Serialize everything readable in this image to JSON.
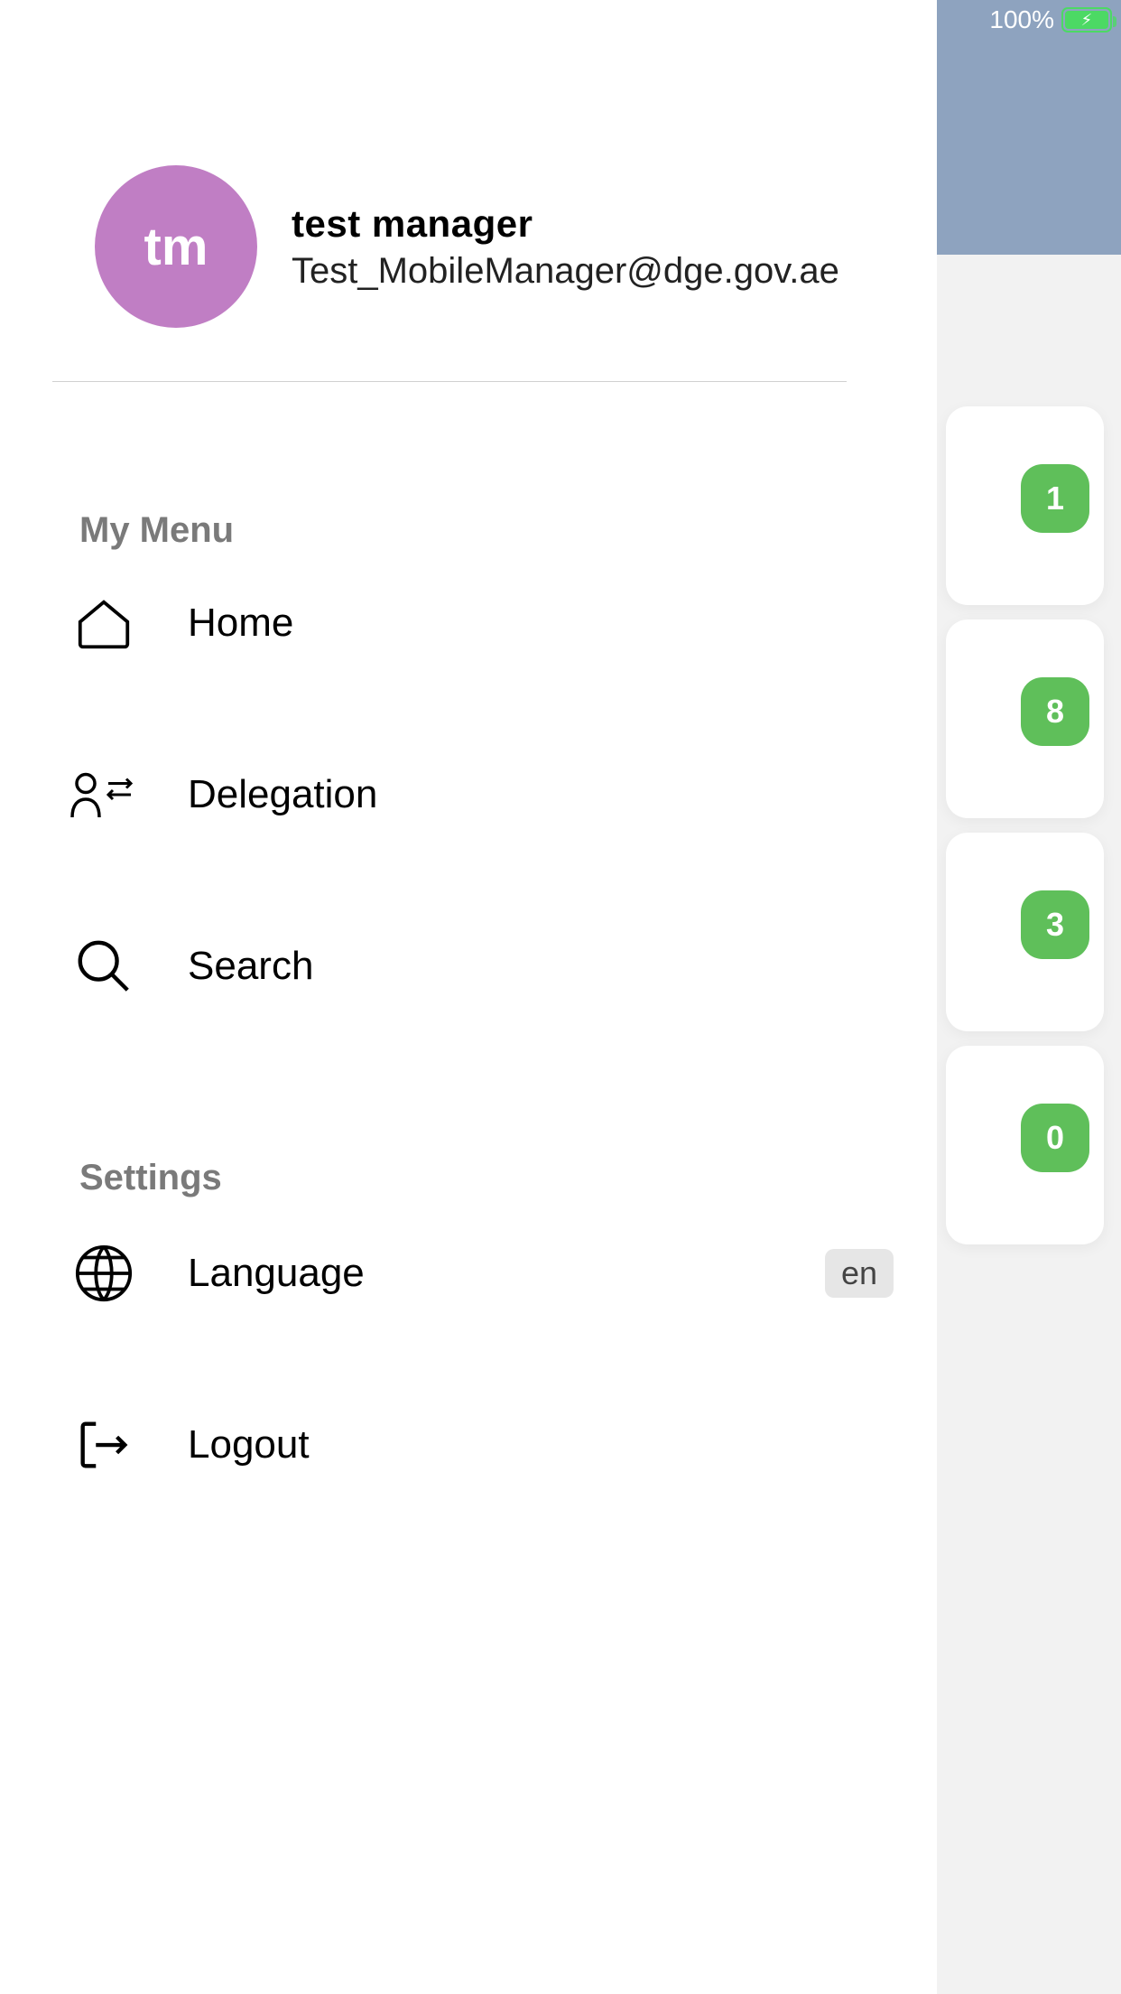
{
  "status": {
    "battery_label": "100%"
  },
  "profile": {
    "initials": "tm",
    "name": "test  manager",
    "email": "Test_MobileManager@dge.gov.ae"
  },
  "sections": {
    "my_menu_title": "My Menu",
    "settings_title": "Settings"
  },
  "menu": {
    "home": "Home",
    "delegation": "Delegation",
    "search": "Search",
    "language": "Language",
    "language_value": "en",
    "logout": "Logout"
  },
  "badges": [
    "1",
    "8",
    "3",
    "0"
  ]
}
